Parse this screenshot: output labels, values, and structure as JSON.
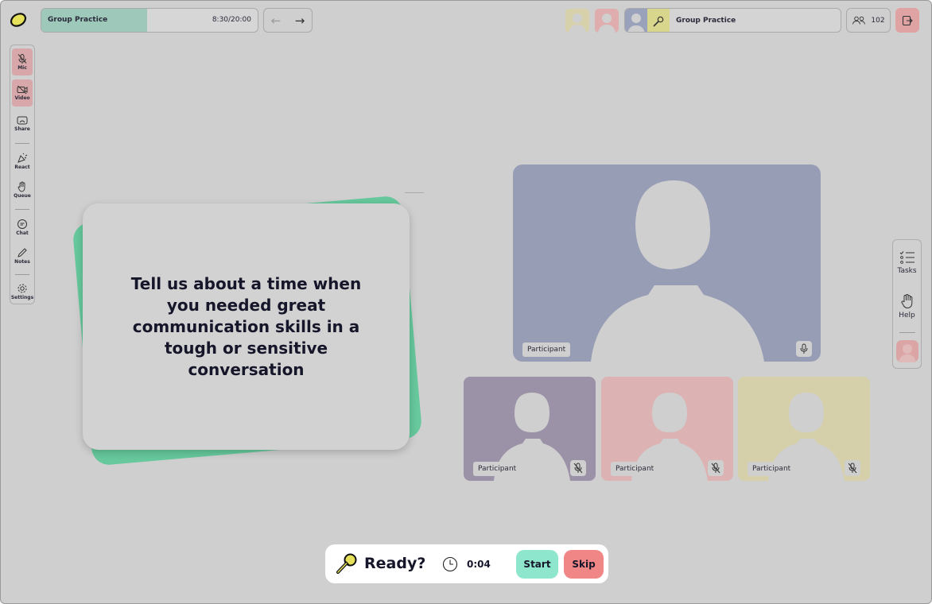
{
  "session": {
    "title": "Group Practice",
    "time": "8:30/20:00",
    "progress_fraction": 0.49
  },
  "speaker": {
    "name": "Group Practice"
  },
  "participants_count": "102",
  "toolbar": {
    "mic": "Mic",
    "video": "Video",
    "share": "Share",
    "react": "React",
    "queue": "Queue",
    "chat": "Chat",
    "notes": "Notes",
    "settings": "Settings"
  },
  "sidebar_right": {
    "tasks": "Tasks",
    "help": "Help"
  },
  "card": {
    "prompt": "Tell us about a time when you needed great communication skills in a tough or sensitive conversation"
  },
  "tiles": [
    {
      "label": "Participant",
      "color": "#979db5",
      "muted": false
    },
    {
      "label": "Participant",
      "color": "#9c92a8",
      "muted": true
    },
    {
      "label": "Participant",
      "color": "#dcb2b2",
      "muted": true
    },
    {
      "label": "Participant",
      "color": "#d5cfaa",
      "muted": true
    }
  ],
  "bottom": {
    "ready": "Ready?",
    "timer": "0:04",
    "start": "Start",
    "skip": "Skip"
  },
  "colors": {
    "background": "#cfcfcf",
    "card_accent": "#66c89c",
    "start": "#8ee6cc",
    "skip": "#f08686",
    "leave": "#e0a3a3",
    "progress": "#9ec9ba"
  },
  "icons": [
    "logo-icon",
    "arrow-left-icon",
    "arrow-right-icon",
    "microphone-icon",
    "people-icon",
    "exit-icon",
    "mic-off-icon",
    "video-off-icon",
    "share-screen-icon",
    "react-icon",
    "raise-hand-icon",
    "chat-icon",
    "pencil-icon",
    "gear-icon",
    "tasks-icon",
    "hand-icon",
    "clock-icon"
  ]
}
